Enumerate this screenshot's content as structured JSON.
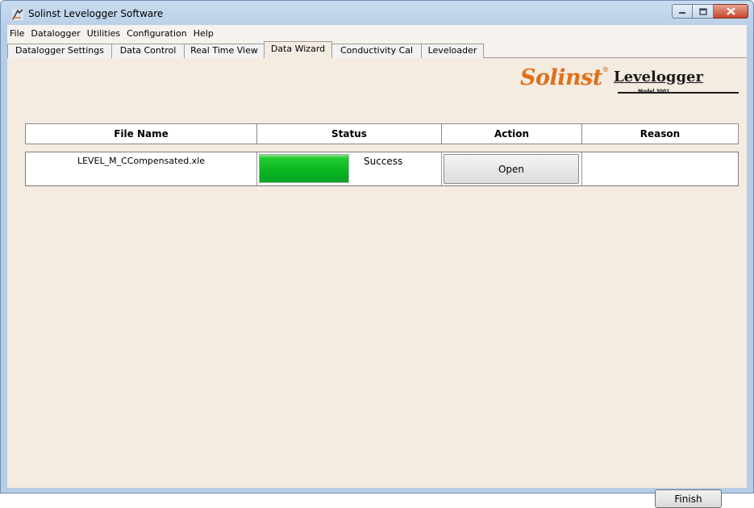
{
  "window": {
    "title": "Solinst Levelogger Software",
    "icon": "solinst-app-icon"
  },
  "menu": [
    "File",
    "Datalogger",
    "Utilities",
    "Configuration",
    "Help"
  ],
  "tabs": [
    {
      "label": "Datalogger Settings",
      "active": false
    },
    {
      "label": "Data Control",
      "active": false
    },
    {
      "label": "Real Time View",
      "active": false
    },
    {
      "label": "Data Wizard",
      "active": true
    },
    {
      "label": "Conductivity Cal",
      "active": false
    },
    {
      "label": "Leveloader",
      "active": false
    }
  ],
  "logo": {
    "brand": "Solinst",
    "product": "Levelogger",
    "model": "Model 3001"
  },
  "table": {
    "headers": [
      "File Name",
      "Status",
      "Action",
      "Reason"
    ],
    "rows": [
      {
        "file_name": "LEVEL_M_CCompensated.xle",
        "progress_percent": 100,
        "status": "Success",
        "action": "Open",
        "reason": ""
      }
    ]
  },
  "footer": {
    "finish_label": "Finish"
  },
  "colors": {
    "logo_orange": "#e0701a",
    "progress_green": "#08b51e",
    "background": "#f4ebe1"
  }
}
